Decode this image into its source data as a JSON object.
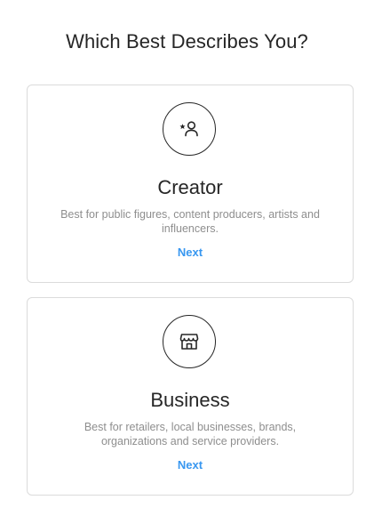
{
  "header": {
    "title": "Which Best Describes You?"
  },
  "cards": [
    {
      "title": "Creator",
      "description": "Best for public figures, content producers, artists and influencers.",
      "action_label": "Next",
      "icon": "star-person-icon"
    },
    {
      "title": "Business",
      "description": "Best for retailers, local businesses, brands, organizations and service providers.",
      "action_label": "Next",
      "icon": "storefront-icon"
    }
  ],
  "colors": {
    "text": "#262626",
    "muted": "#8e8e8e",
    "link": "#3897f0",
    "border": "#dbdbdb"
  }
}
